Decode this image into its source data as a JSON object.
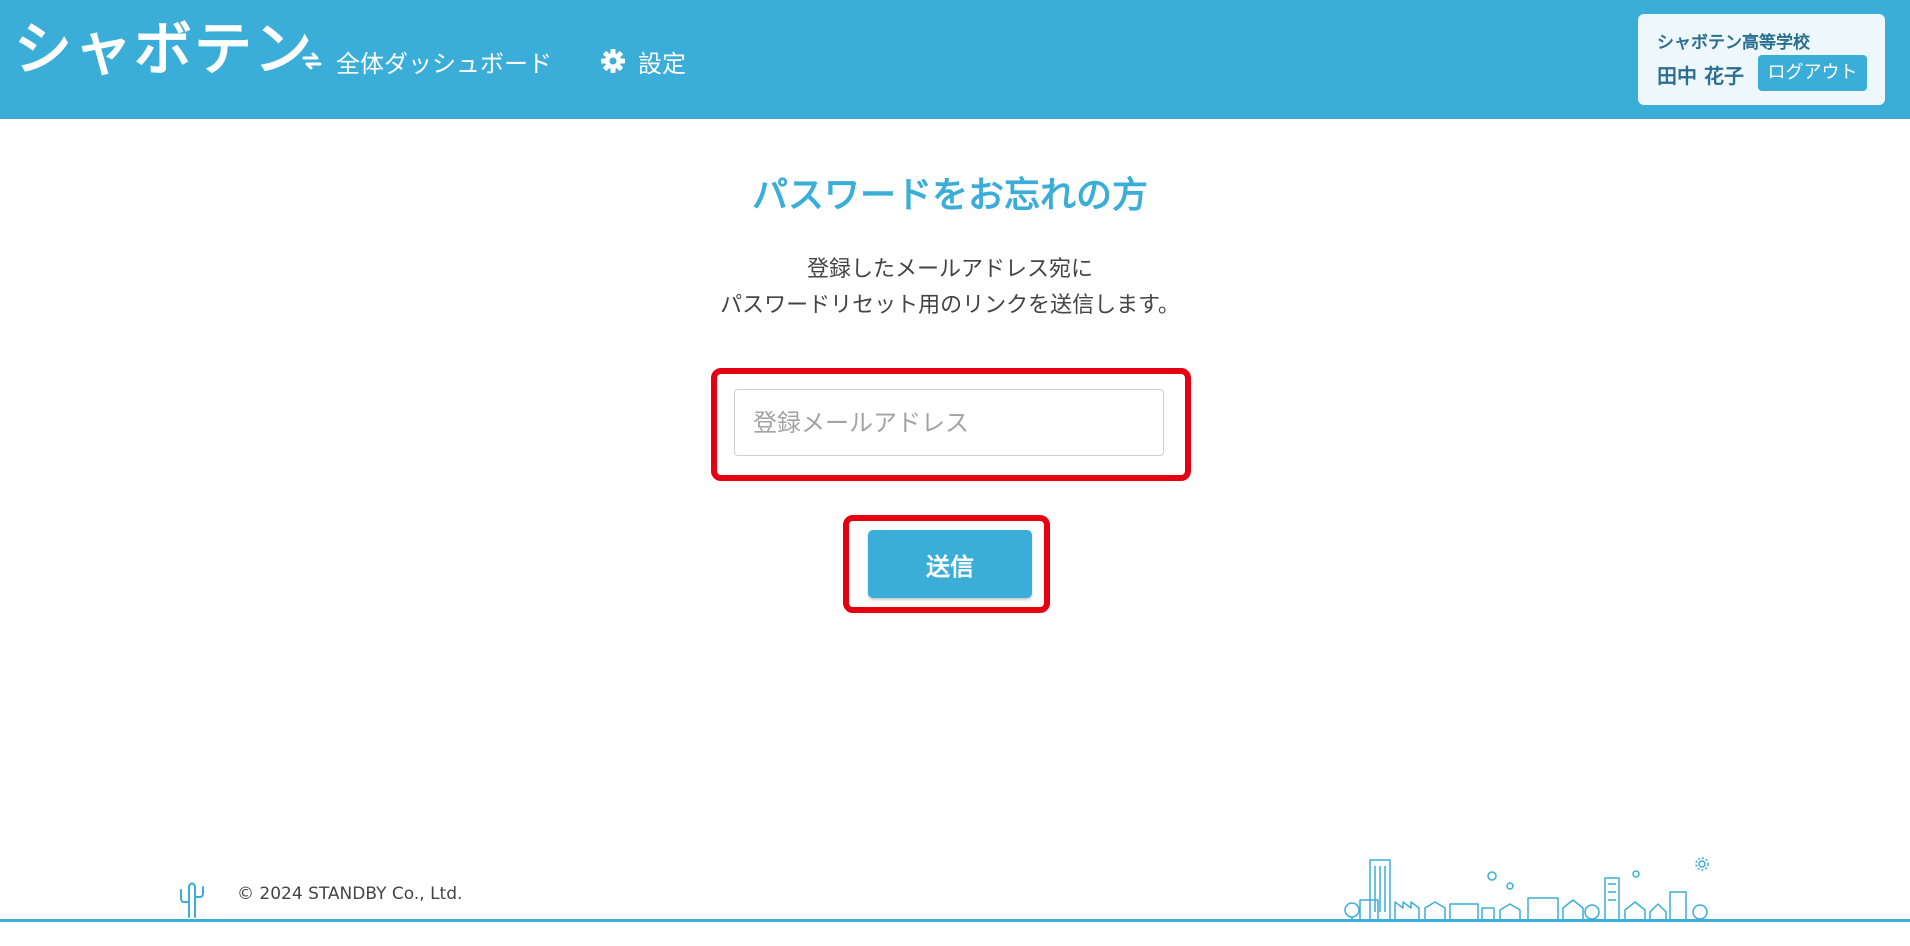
{
  "header": {
    "logo": "シャボテン",
    "nav": [
      {
        "label": "全体ダッシュボード",
        "icon": "sync-icon"
      },
      {
        "label": "設定",
        "icon": "gear-icon"
      }
    ],
    "user": {
      "school": "シャボテン高等学校",
      "name": "田中 花子",
      "logout_label": "ログアウト"
    }
  },
  "main": {
    "title": "パスワードをお忘れの方",
    "description_line1": "登録したメールアドレス宛に",
    "description_line2": "パスワードリセット用のリンクを送信します。",
    "email_placeholder": "登録メールアドレス",
    "submit_label": "送信"
  },
  "footer": {
    "copyright": "© 2024 STANDBY Co., Ltd."
  },
  "colors": {
    "accent": "#3aaed9",
    "highlight": "#e50012"
  }
}
